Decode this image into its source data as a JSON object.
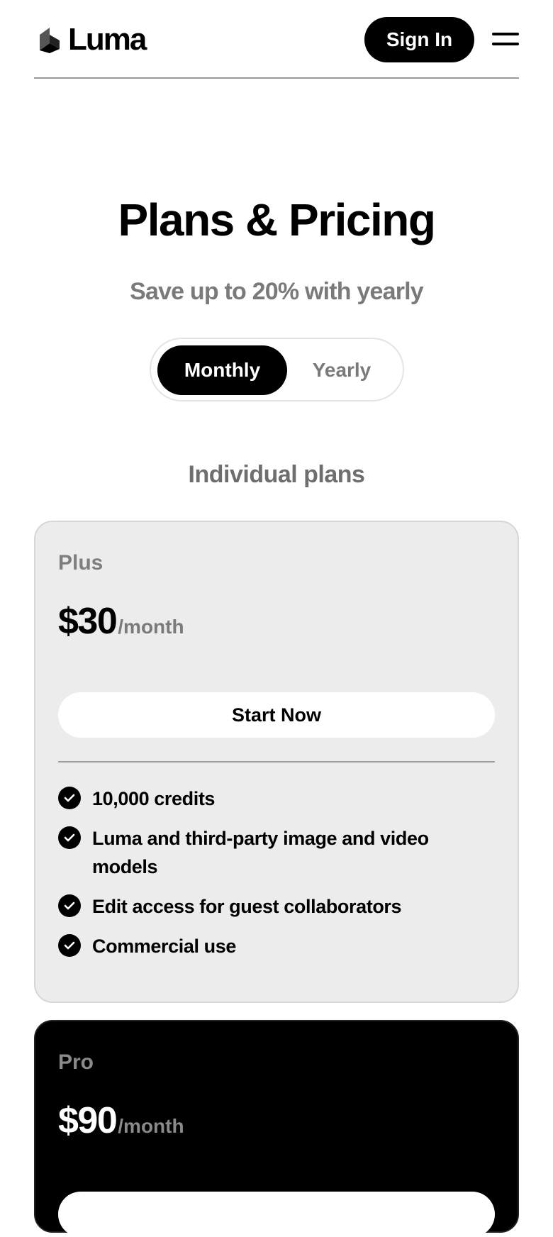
{
  "header": {
    "logo_text": "Luma",
    "logo_icon": "luma-cube-logo",
    "signin_label": "Sign In",
    "menu_icon": "hamburger-menu-icon"
  },
  "hero": {
    "title": "Plans & Pricing",
    "subtitle": "Save up to 20% with yearly",
    "billing_toggle": {
      "options": [
        "Monthly",
        "Yearly"
      ],
      "selected": "Monthly"
    }
  },
  "section": {
    "title": "Individual plans"
  },
  "plans": [
    {
      "name": "Plus",
      "price": "$30",
      "period": "/month",
      "cta": "Start Now",
      "features": [
        "10,000 credits",
        "Luma and third-party image and video models",
        "Edit access for guest collaborators",
        "Commercial use"
      ]
    },
    {
      "name": "Pro",
      "price": "$90",
      "period": "/month",
      "cta": ""
    }
  ],
  "colors": {
    "primary": "#000000",
    "background": "#ffffff",
    "card_light": "#ececec",
    "muted_text": "#7a7a7a"
  }
}
